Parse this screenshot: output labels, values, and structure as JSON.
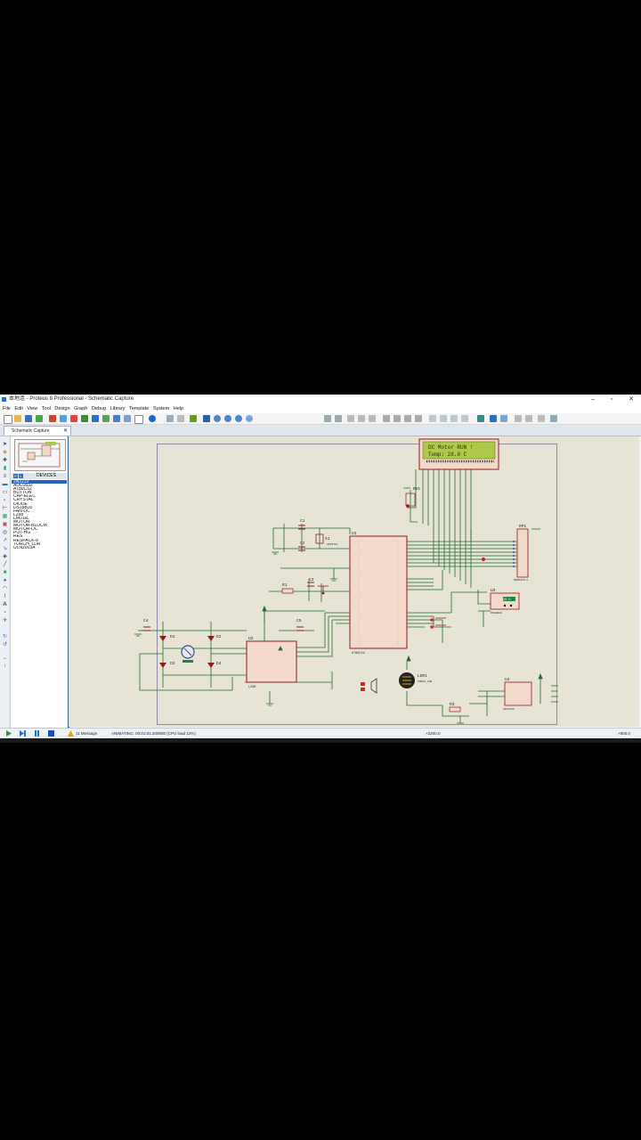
{
  "window": {
    "title": "本地连 - Proteus 8 Professional - Schematic Capture",
    "minimize": "–",
    "restore": "▫",
    "close": "✕"
  },
  "menu": [
    "File",
    "Edit",
    "View",
    "Tool",
    "Design",
    "Graph",
    "Debug",
    "Library",
    "Template",
    "System",
    "Help"
  ],
  "tab": {
    "label": "Schematic Capture",
    "close": "✕"
  },
  "devices": {
    "header": "DEVICES",
    "p_label": "P",
    "l_label": "L",
    "items": [
      "2N2222",
      "ADC0832",
      "AT89C52",
      "BUTTON",
      "CAP-ELEC",
      "CRYSTAL",
      "DIODE",
      "DS18B20",
      "FAN-DC",
      "L298",
      "LM016L",
      "MOTOR",
      "MOTOR-BLDCM",
      "MOTOR-DC",
      "POT-HG",
      "RES",
      "RESPACK-8",
      "TORCH_LDR",
      "ULN2003A"
    ],
    "selected_index": 0
  },
  "lcd": {
    "line1": "DC Motor RUN !",
    "line2": "Temp:  28.0 C"
  },
  "labels": {
    "rv1": "RV1",
    "c1": "C1",
    "c2": "C2",
    "c3": "C3",
    "c4": "C4",
    "c5": "C5",
    "x1": "X1",
    "r1": "R1",
    "r3": "R3",
    "u1": "U1",
    "u2": "U2",
    "u3": "U3",
    "u4": "U4",
    "rp1": "RP1",
    "ldr1": "LDR1",
    "ldr_sub": "TORCH_LDR",
    "d1": "D1",
    "d2": "D2",
    "d3": "D3",
    "d4": "D4",
    "u1_part": "AT89C52",
    "crystal": "CRYSTAL",
    "respack": "RESPACK-8",
    "l298": "L298",
    "adc": "ADC0832",
    "ds18b20": "DS18B20",
    "temp_readout": "28.0"
  },
  "status": {
    "messages": "11 Message",
    "animating": "ANIMATING: 00:01:01.200000 (CPU load 12%)",
    "coord_x": "+2200.0",
    "coord_y": "+800.0"
  },
  "colors": {
    "wire": "#1e6b2a",
    "component": "#8b1a1a",
    "chip_fill": "#f3d9c9",
    "lcd_bg": "#aec84a",
    "canvas_bg": "#e7e4d6",
    "selection": "#1e63c6"
  }
}
